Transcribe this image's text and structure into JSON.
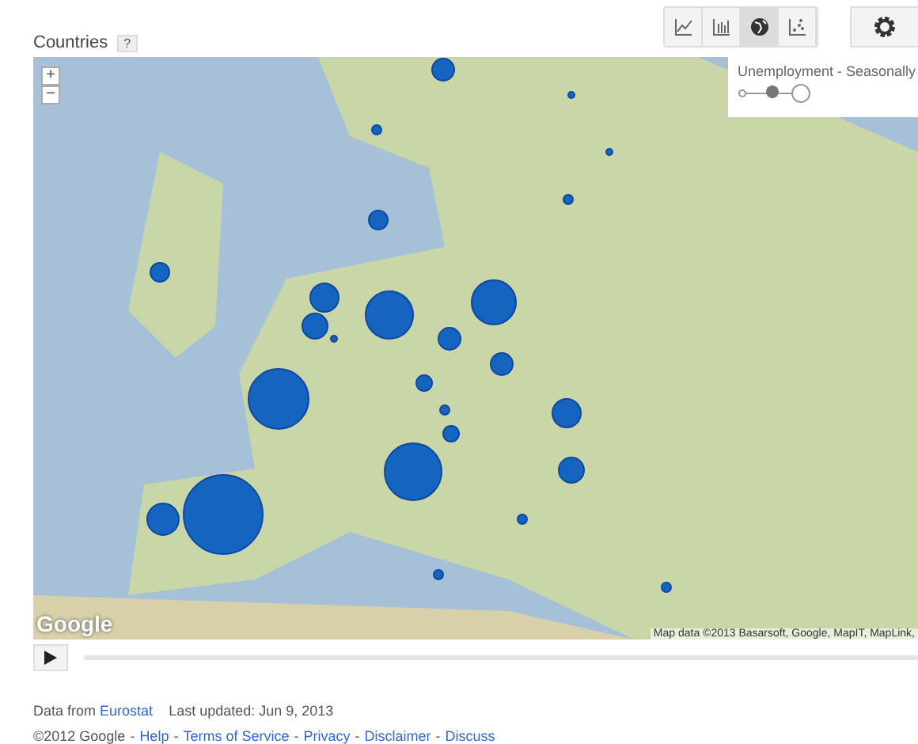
{
  "header": {
    "title": "Countries",
    "help": "?"
  },
  "chart_types": [
    {
      "kind": "line",
      "selected": false
    },
    {
      "kind": "bar",
      "selected": false
    },
    {
      "kind": "map",
      "selected": true
    },
    {
      "kind": "scatter",
      "selected": false
    }
  ],
  "map": {
    "zoom_in": "+",
    "zoom_out": "−",
    "legend": {
      "title": "Unemployment - Seasonally",
      "level": 0.5
    },
    "logo": "Google",
    "attribution": "Map data ©2013 Basarsoft, Google, MapIT, MapLink, "
  },
  "source": {
    "prefix": "Data from",
    "link": "Eurostat",
    "updated": "Last updated: Jun 9, 2013"
  },
  "footer": [
    {
      "kind": "text",
      "text": "©2012 Google"
    },
    {
      "kind": "separator",
      "text": "-"
    },
    {
      "kind": "link",
      "text": "Help"
    },
    {
      "kind": "separator",
      "text": "-"
    },
    {
      "kind": "link",
      "text": "Terms of Service"
    },
    {
      "kind": "separator",
      "text": "-"
    },
    {
      "kind": "link",
      "text": "Privacy"
    },
    {
      "kind": "separator",
      "text": "-"
    },
    {
      "kind": "link",
      "text": "Disclaimer"
    },
    {
      "kind": "separator",
      "text": "-"
    },
    {
      "kind": "link",
      "text": "Discuss"
    }
  ]
}
